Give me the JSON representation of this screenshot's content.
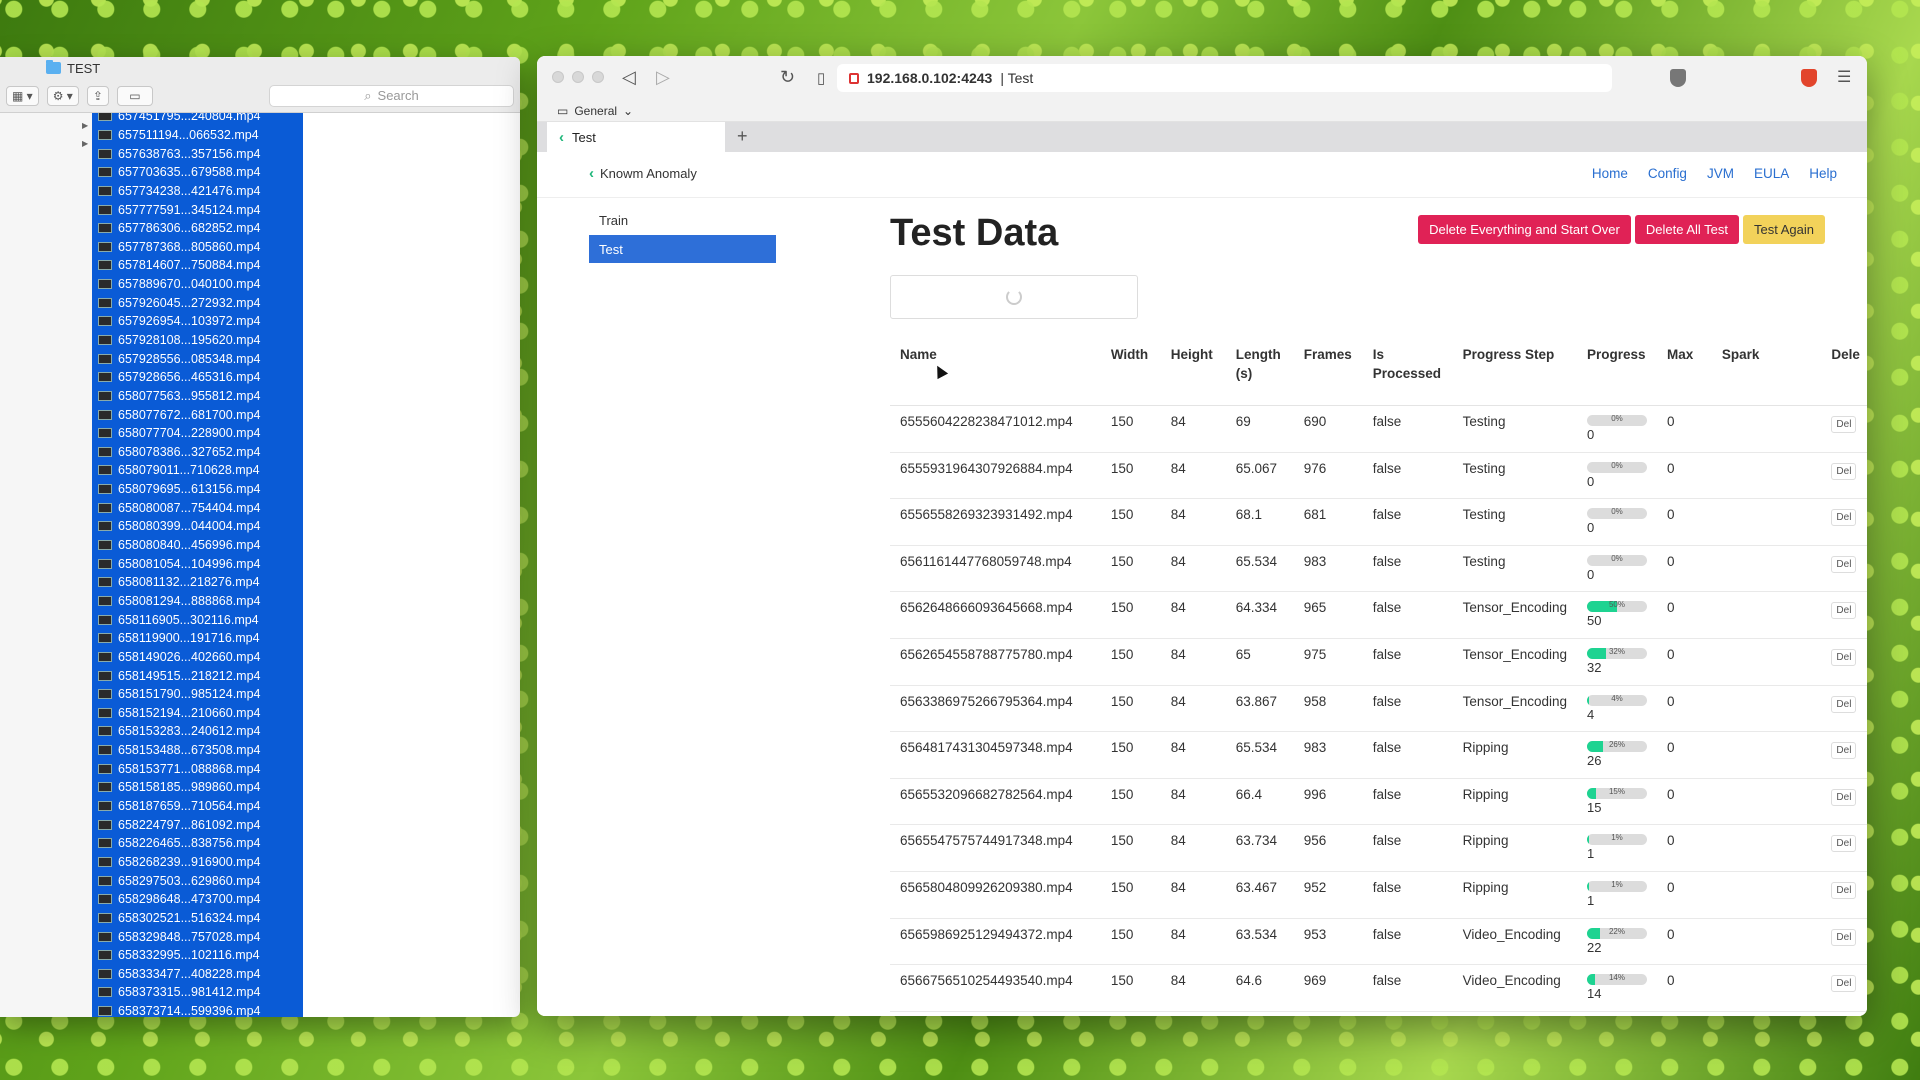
{
  "finder": {
    "title": "TEST",
    "search_placeholder": "Search",
    "files": [
      "657451795...240804.mp4",
      "657511194...066532.mp4",
      "657638763...357156.mp4",
      "657703635...679588.mp4",
      "657734238...421476.mp4",
      "657777591...345124.mp4",
      "657786306...682852.mp4",
      "657787368...805860.mp4",
      "657814607...750884.mp4",
      "657889670...040100.mp4",
      "657926045...272932.mp4",
      "657926954...103972.mp4",
      "657928108...195620.mp4",
      "657928556...085348.mp4",
      "657928656...465316.mp4",
      "658077563...955812.mp4",
      "658077672...681700.mp4",
      "658077704...228900.mp4",
      "658078386...327652.mp4",
      "658079011...710628.mp4",
      "658079695...613156.mp4",
      "658080087...754404.mp4",
      "658080399...044004.mp4",
      "658080840...456996.mp4",
      "658081054...104996.mp4",
      "658081132...218276.mp4",
      "658081294...888868.mp4",
      "658116905...302116.mp4",
      "658119900...191716.mp4",
      "658149026...402660.mp4",
      "658149515...218212.mp4",
      "658151790...985124.mp4",
      "658152194...210660.mp4",
      "658153283...240612.mp4",
      "658153488...673508.mp4",
      "658153771...088868.mp4",
      "658158185...989860.mp4",
      "658187659...710564.mp4",
      "658224797...861092.mp4",
      "658226465...838756.mp4",
      "658268239...916900.mp4",
      "658297503...629860.mp4",
      "658298648...473700.mp4",
      "658302521...516324.mp4",
      "658329848...757028.mp4",
      "658332995...102116.mp4",
      "658333477...408228.mp4",
      "658373315...981412.mp4",
      "658373714...599396.mp4"
    ]
  },
  "browser": {
    "url_host": "192.168.0.102:4243",
    "url_suffix": "| Test",
    "bookmark_folder": "General",
    "tab_title": "Test"
  },
  "app": {
    "brand": "Knowm Anomaly",
    "nav": [
      "Home",
      "Config",
      "JVM",
      "EULA",
      "Help"
    ],
    "sidebar": [
      "Train",
      "Test"
    ],
    "title": "Test Data",
    "buttons": {
      "delete_everything": "Delete Everything and Start Over",
      "delete_all_test": "Delete All Test",
      "test_again": "Test Again"
    },
    "columns": [
      "Name",
      "Width",
      "Height",
      "Length (s)",
      "Frames",
      "Is Processed",
      "Progress Step",
      "Progress",
      "Max",
      "Spark",
      "Dele"
    ],
    "delete_label": "Del",
    "rows": [
      {
        "name": "6555604228238471012.mp4",
        "width": "150",
        "height": "84",
        "length": "69",
        "frames": "690",
        "processed": "false",
        "step": "Testing",
        "progress": 0,
        "max": "0"
      },
      {
        "name": "6555931964307926884.mp4",
        "width": "150",
        "height": "84",
        "length": "65.067",
        "frames": "976",
        "processed": "false",
        "step": "Testing",
        "progress": 0,
        "max": "0"
      },
      {
        "name": "6556558269323931492.mp4",
        "width": "150",
        "height": "84",
        "length": "68.1",
        "frames": "681",
        "processed": "false",
        "step": "Testing",
        "progress": 0,
        "max": "0"
      },
      {
        "name": "6561161447768059748.mp4",
        "width": "150",
        "height": "84",
        "length": "65.534",
        "frames": "983",
        "processed": "false",
        "step": "Testing",
        "progress": 0,
        "max": "0"
      },
      {
        "name": "6562648666093645668.mp4",
        "width": "150",
        "height": "84",
        "length": "64.334",
        "frames": "965",
        "processed": "false",
        "step": "Tensor_Encoding",
        "progress": 50,
        "max": "0"
      },
      {
        "name": "6562654558788775780.mp4",
        "width": "150",
        "height": "84",
        "length": "65",
        "frames": "975",
        "processed": "false",
        "step": "Tensor_Encoding",
        "progress": 32,
        "max": "0"
      },
      {
        "name": "6563386975266795364.mp4",
        "width": "150",
        "height": "84",
        "length": "63.867",
        "frames": "958",
        "processed": "false",
        "step": "Tensor_Encoding",
        "progress": 4,
        "max": "0"
      },
      {
        "name": "6564817431304597348.mp4",
        "width": "150",
        "height": "84",
        "length": "65.534",
        "frames": "983",
        "processed": "false",
        "step": "Ripping",
        "progress": 26,
        "max": "0"
      },
      {
        "name": "6565532096682782564.mp4",
        "width": "150",
        "height": "84",
        "length": "66.4",
        "frames": "996",
        "processed": "false",
        "step": "Ripping",
        "progress": 15,
        "max": "0"
      },
      {
        "name": "6565547575744917348.mp4",
        "width": "150",
        "height": "84",
        "length": "63.734",
        "frames": "956",
        "processed": "false",
        "step": "Ripping",
        "progress": 1,
        "max": "0"
      },
      {
        "name": "6565804809926209380.mp4",
        "width": "150",
        "height": "84",
        "length": "63.467",
        "frames": "952",
        "processed": "false",
        "step": "Ripping",
        "progress": 1,
        "max": "0"
      },
      {
        "name": "6565986925129494372.mp4",
        "width": "150",
        "height": "84",
        "length": "63.534",
        "frames": "953",
        "processed": "false",
        "step": "Video_Encoding",
        "progress": 22,
        "max": "0"
      },
      {
        "name": "6566756510254493540.mp4",
        "width": "150",
        "height": "84",
        "length": "64.6",
        "frames": "969",
        "processed": "false",
        "step": "Video_Encoding",
        "progress": 14,
        "max": "0"
      }
    ]
  },
  "colors": {
    "selection": "#0a5bd6",
    "primary": "#2e6fd8",
    "danger": "#e02256",
    "warning": "#f2d25a",
    "progress": "#1ed391"
  },
  "icons": [
    "folder-icon",
    "grid-view-icon",
    "gear-icon",
    "share-icon",
    "tag-icon",
    "search-icon",
    "back-icon",
    "forward-icon",
    "reload-icon",
    "bookmark-icon",
    "lock-icon",
    "brave-shield-icon",
    "brave-lion-icon",
    "menu-icon",
    "knowm-logo-icon",
    "spinner-icon",
    "cursor-icon"
  ]
}
